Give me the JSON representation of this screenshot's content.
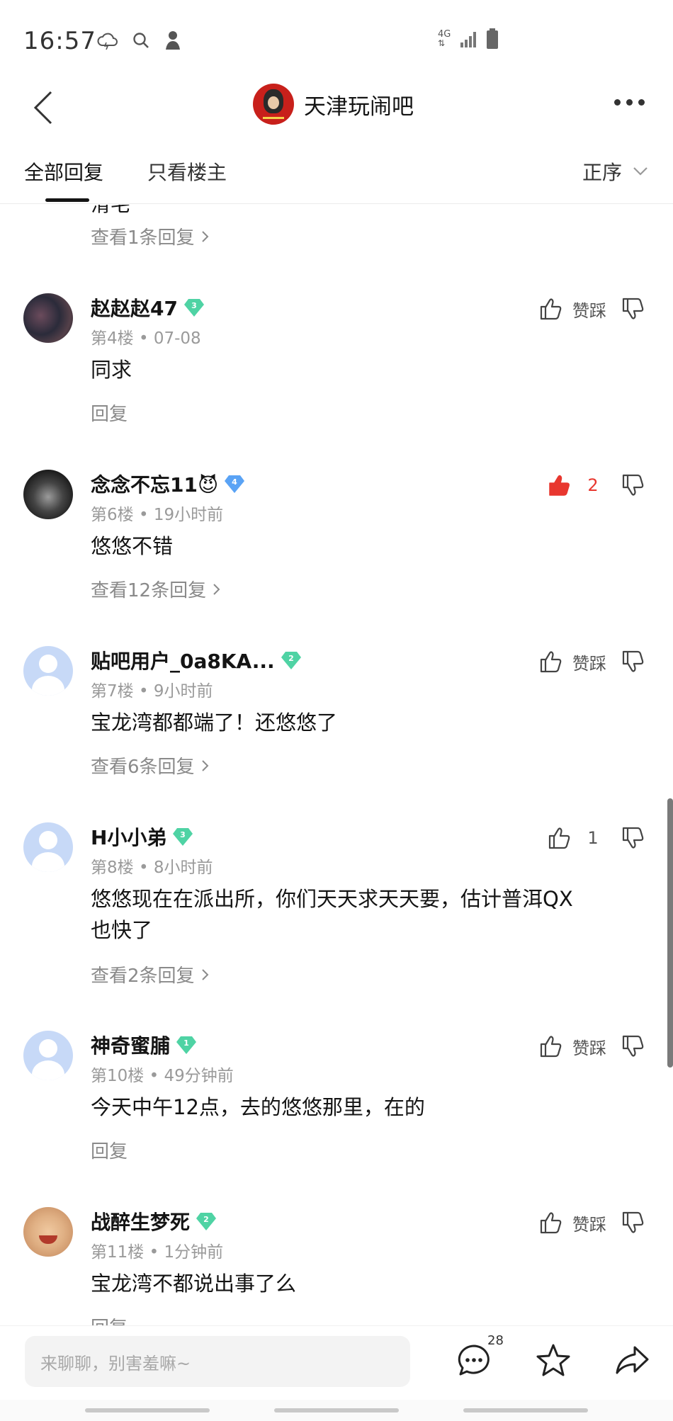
{
  "status_bar": {
    "time": "16:57",
    "network": "4G",
    "icons": [
      "cloud-icon",
      "search-icon",
      "person-icon",
      "signal-icon",
      "battery-icon"
    ]
  },
  "header": {
    "forum_name": "天津玩闹吧"
  },
  "tabs": {
    "all": "全部回复",
    "owner_only": "只看楼主",
    "sort": "正序"
  },
  "partial": {
    "text_fragment": "滑宅",
    "view_replies": "查看1条回复"
  },
  "posts": [
    {
      "username": "赵赵赵47",
      "level": "3",
      "level_color": "#4fd3a4",
      "meta": "第4楼 • 07-08",
      "body": "同求",
      "action": "回复",
      "vote_label": "赞踩",
      "liked": false
    },
    {
      "username": "念念不忘11😈",
      "level": "4",
      "level_color": "#5aa3f5",
      "meta": "第6楼 • 19小时前",
      "body": "悠悠不错",
      "action": "查看12条回复",
      "vote_label": "2",
      "liked": true
    },
    {
      "username": "贴吧用户_0a8KA...",
      "level": "2",
      "level_color": "#4fd3a4",
      "meta": "第7楼 • 9小时前",
      "body": "宝龙湾都都端了！还悠悠了",
      "action": "查看6条回复",
      "vote_label": "赞踩",
      "liked": false
    },
    {
      "username": "H小小弟",
      "level": "3",
      "level_color": "#4fd3a4",
      "meta": "第8楼 • 8小时前",
      "body_line1": "悠悠现在在派出所，你们天天求天天要，估计普洱QX",
      "body_line2": "也快了",
      "action": "查看2条回复",
      "vote_label": "1",
      "liked": false
    },
    {
      "username": "神奇蜜脯",
      "level": "1",
      "level_color": "#4fd3a4",
      "meta": "第10楼 • 49分钟前",
      "body": "今天中午12点，去的悠悠那里，在的",
      "action": "回复",
      "vote_label": "赞踩",
      "liked": false
    },
    {
      "username": "战醉生梦死",
      "level": "2",
      "level_color": "#4fd3a4",
      "meta": "第11楼 • 1分钟前",
      "body": "宝龙湾不都说出事了么",
      "action": "回复",
      "vote_label": "赞踩",
      "liked": false
    }
  ],
  "bottom_bar": {
    "input_placeholder": "来聊聊，别害羞嘛~",
    "comment_count": "28"
  },
  "colors": {
    "liked_red": "#e8372f",
    "secondary_text": "#8a8a8a"
  }
}
